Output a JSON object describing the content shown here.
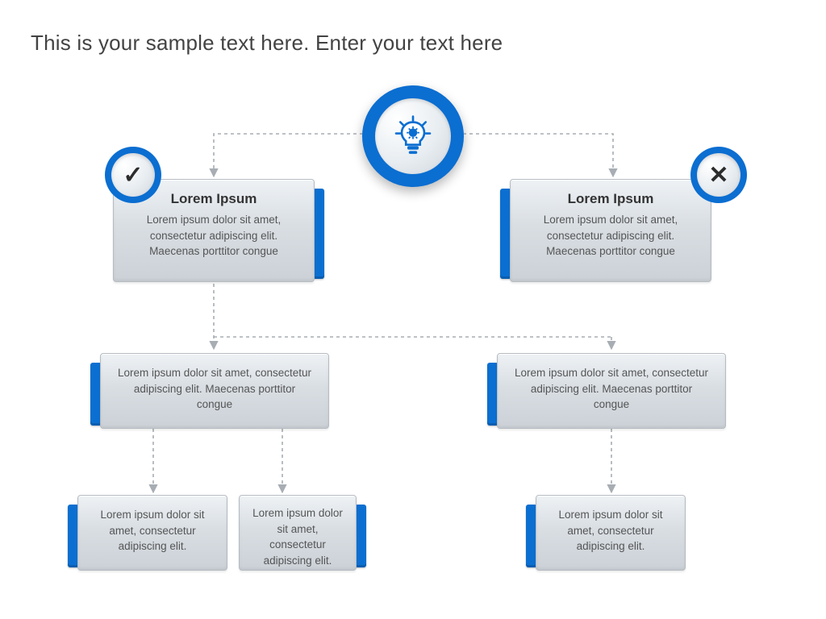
{
  "title": "This is your sample text here. Enter your text here",
  "cards": {
    "left1": {
      "heading": "Lorem Ipsum",
      "body": "Lorem ipsum dolor sit amet, consectetur adipiscing elit. Maecenas porttitor congue"
    },
    "right1": {
      "heading": "Lorem Ipsum",
      "body": "Lorem ipsum dolor sit amet, consectetur adipiscing elit. Maecenas porttitor congue"
    },
    "left2": {
      "body": "Lorem ipsum dolor sit amet, consectetur adipiscing elit. Maecenas porttitor congue"
    },
    "right2": {
      "body": "Lorem ipsum dolor sit amet, consectetur adipiscing elit. Maecenas porttitor congue"
    },
    "bl1": {
      "body": "Lorem ipsum dolor sit amet, consectetur adipiscing elit."
    },
    "bl2": {
      "body": "Lorem ipsum dolor sit amet, consectetur adipiscing elit."
    },
    "br": {
      "body": "Lorem ipsum dolor sit amet, consectetur adipiscing elit."
    }
  },
  "icons": {
    "top": "lightbulb-gear",
    "yes": "✓",
    "no": "✕"
  },
  "colors": {
    "accent": "#0b6ed1"
  }
}
